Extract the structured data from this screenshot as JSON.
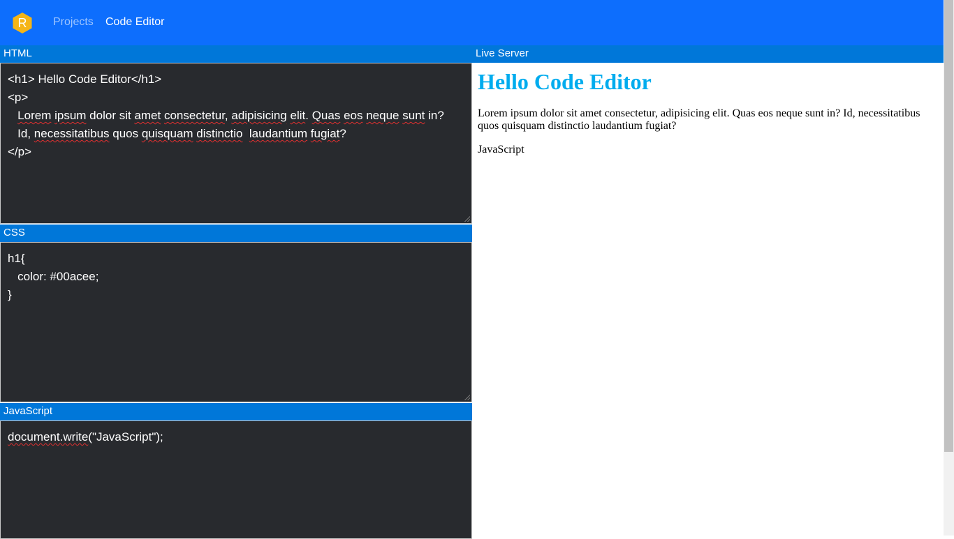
{
  "navbar": {
    "logo_letter": "R",
    "links": [
      {
        "label": "Projects"
      },
      {
        "label": "Code Editor"
      }
    ],
    "colors": {
      "background": "#0d6efd",
      "logo": "#f5b517"
    }
  },
  "html_panel": {
    "title": "HTML",
    "lines": [
      "<h1> Hello Code Editor</h1>",
      "<p>",
      "   Lorem ipsum dolor sit amet consectetur, adipisicing elit. Quas eos neque sunt in?",
      "   Id, necessitatibus quos quisquam distinctio  laudantium fugiat?",
      "</p>"
    ]
  },
  "css_panel": {
    "title": "CSS",
    "lines": [
      "h1{",
      "   color: #00acee;",
      "}"
    ]
  },
  "js_panel": {
    "title": "JavaScript",
    "lines": [
      "document.write(\"JavaScript\");"
    ]
  },
  "live_server": {
    "title": "Live Server",
    "heading": "Hello Code Editor",
    "paragraph": "Lorem ipsum dolor sit amet consectetur, adipisicing elit. Quas eos neque sunt in? Id, necessitatibus quos quisquam distinctio laudantium fugiat?",
    "js_output": "JavaScript",
    "heading_color": "#00acee"
  },
  "colors": {
    "panel_header": "#0077d9",
    "editor_bg": "#282a2e"
  }
}
